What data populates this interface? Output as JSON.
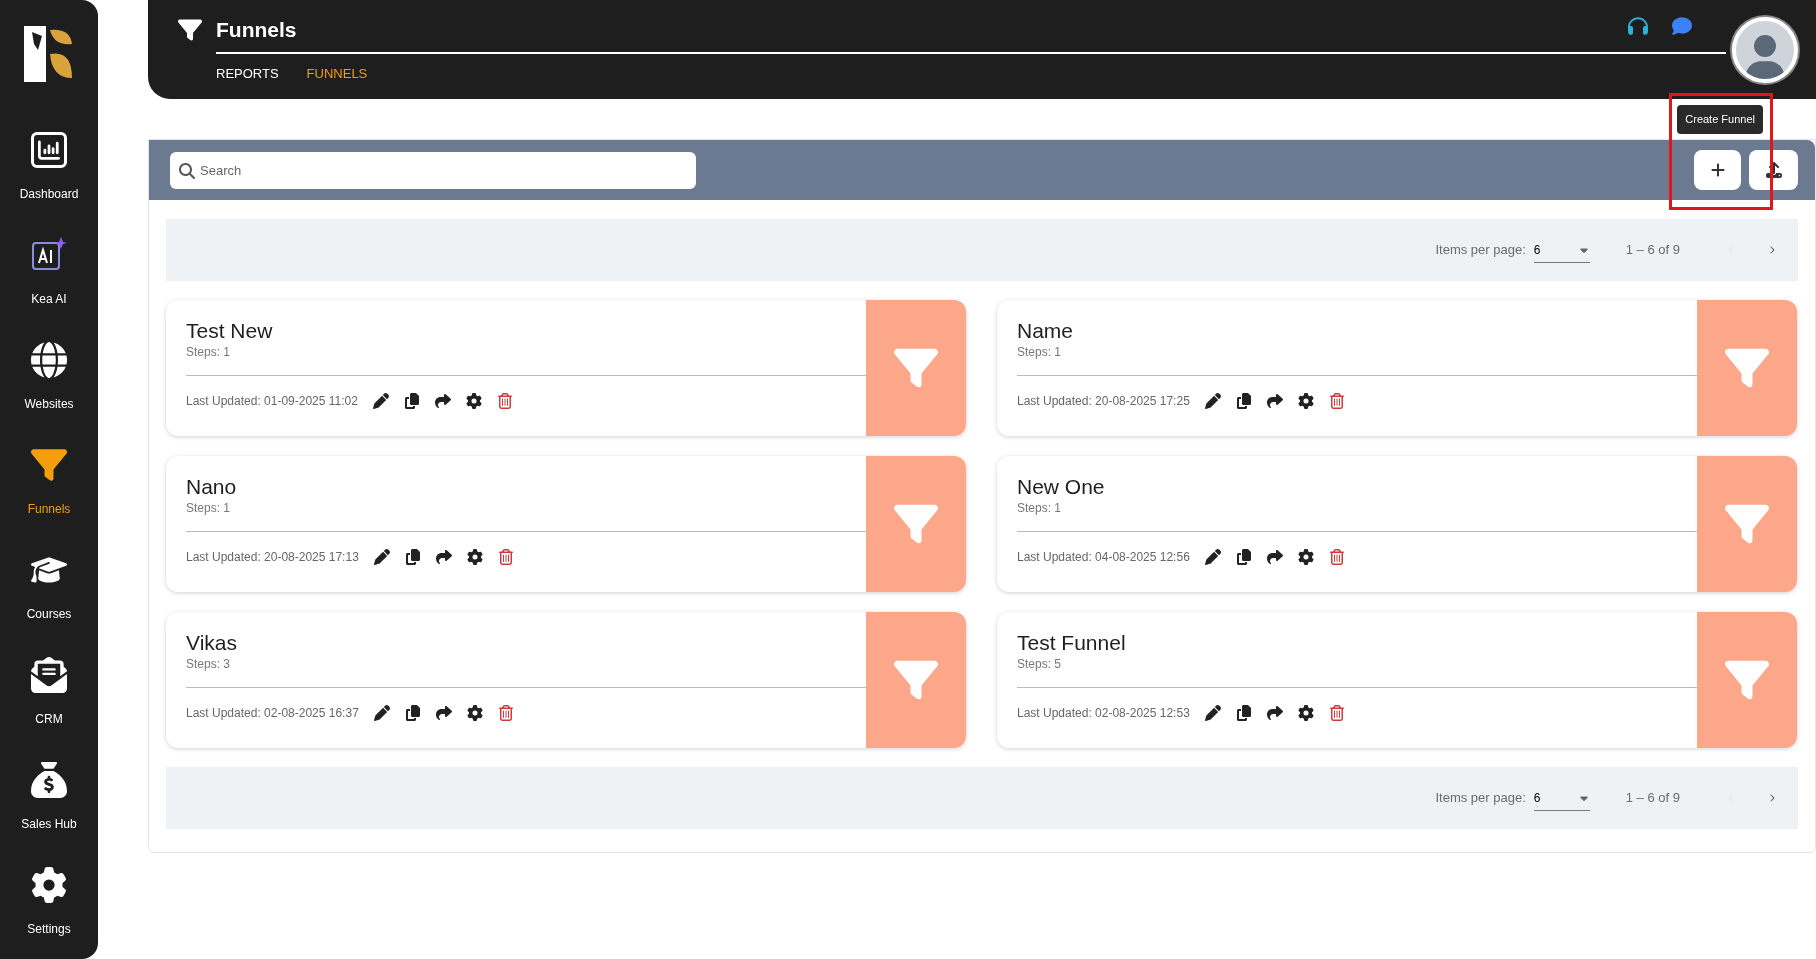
{
  "sidebar": {
    "items": [
      {
        "kind": "dashboard",
        "label": "Dashboard",
        "selected": false
      },
      {
        "kind": "ai",
        "label": "Kea AI",
        "selected": false
      },
      {
        "kind": "websites",
        "label": "Websites",
        "selected": false
      },
      {
        "kind": "funnels",
        "label": "Funnels",
        "selected": true
      },
      {
        "kind": "courses",
        "label": "Courses",
        "selected": false
      },
      {
        "kind": "crm",
        "label": "CRM",
        "selected": false
      },
      {
        "kind": "sales",
        "label": "Sales Hub",
        "selected": false
      },
      {
        "kind": "settings",
        "label": "Settings",
        "selected": false
      }
    ]
  },
  "header": {
    "title": "Funnels",
    "tabs": [
      {
        "label": "REPORTS",
        "selected": false
      },
      {
        "label": "FUNNELS",
        "selected": true
      }
    ]
  },
  "toolbar": {
    "search": {
      "placeholder": "Search"
    },
    "tooltip": "Create Funnel",
    "highlighted": true
  },
  "paginators": [
    {
      "label": "Items per page:",
      "per_page": "6",
      "range": "1 – 6 of 9",
      "prev_disabled": true
    },
    {
      "label": "Items per page:",
      "per_page": "6",
      "range": "1 – 6 of 9",
      "prev_disabled": true
    }
  ],
  "cards": [
    {
      "name": "Test New",
      "steps": "Steps: 1",
      "updated": "Last Updated: 01-09-2025 11:02"
    },
    {
      "name": "Name",
      "steps": "Steps: 1",
      "updated": "Last Updated: 20-08-2025 17:25"
    },
    {
      "name": "Nano",
      "steps": "Steps: 1",
      "updated": "Last Updated: 20-08-2025 17:13"
    },
    {
      "name": "New One",
      "steps": "Steps: 1",
      "updated": "Last Updated: 04-08-2025 12:56"
    },
    {
      "name": "Vikas",
      "steps": "Steps: 3",
      "updated": "Last Updated: 02-08-2025 16:37"
    },
    {
      "name": "Test Funnel",
      "steps": "Steps: 5",
      "updated": "Last Updated: 02-08-2025 12:53"
    }
  ]
}
